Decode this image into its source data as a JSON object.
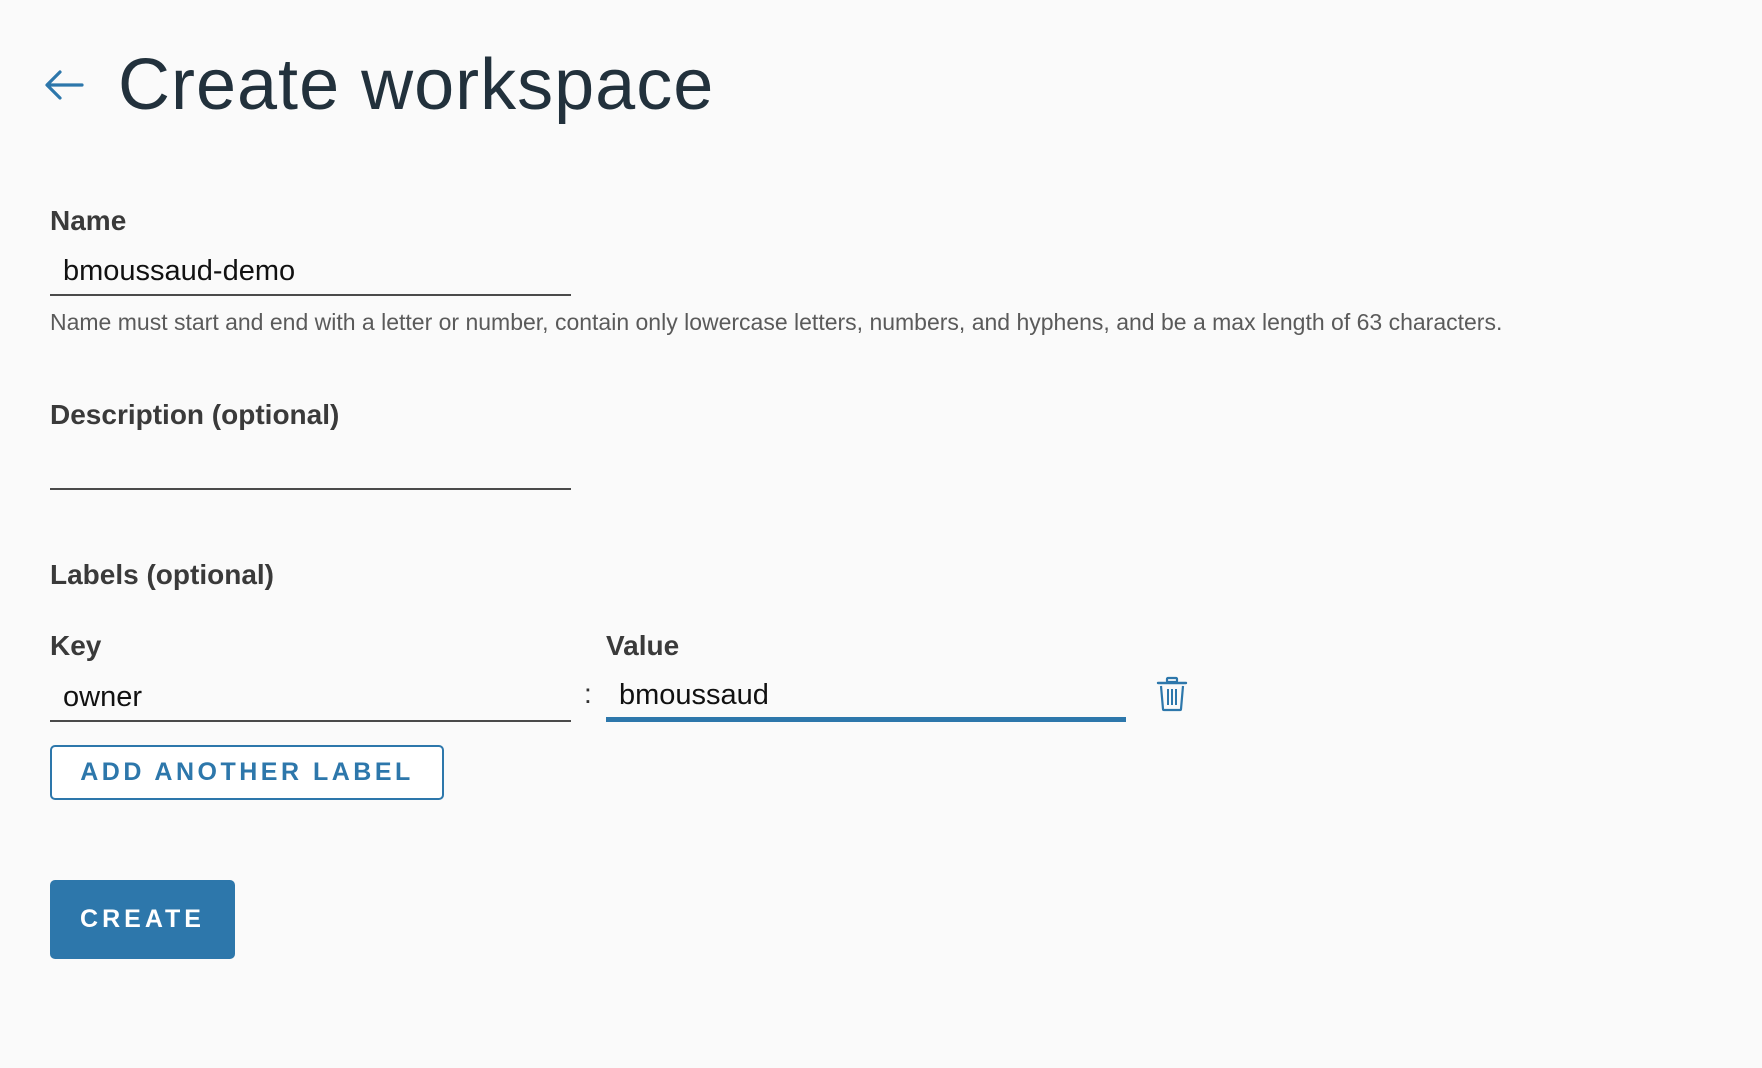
{
  "header": {
    "title": "Create workspace",
    "back_icon": "arrow-left-icon"
  },
  "form": {
    "name": {
      "label": "Name",
      "value": "bmoussaud-demo",
      "helper": "Name must start and end with a letter or number, contain only lowercase letters, numbers, and hyphens, and be a max length of 63 characters."
    },
    "description": {
      "label": "Description (optional)",
      "value": ""
    },
    "labels": {
      "section_label": "Labels (optional)",
      "key_header": "Key",
      "value_header": "Value",
      "separator": ":",
      "rows": [
        {
          "key": "owner",
          "value": "bmoussaud"
        }
      ],
      "delete_icon": "trash-icon",
      "add_button": "ADD ANOTHER LABEL"
    },
    "submit_label": "CREATE"
  },
  "colors": {
    "accent": "#2d77ab",
    "background": "#fafafa",
    "title": "#22313c"
  }
}
